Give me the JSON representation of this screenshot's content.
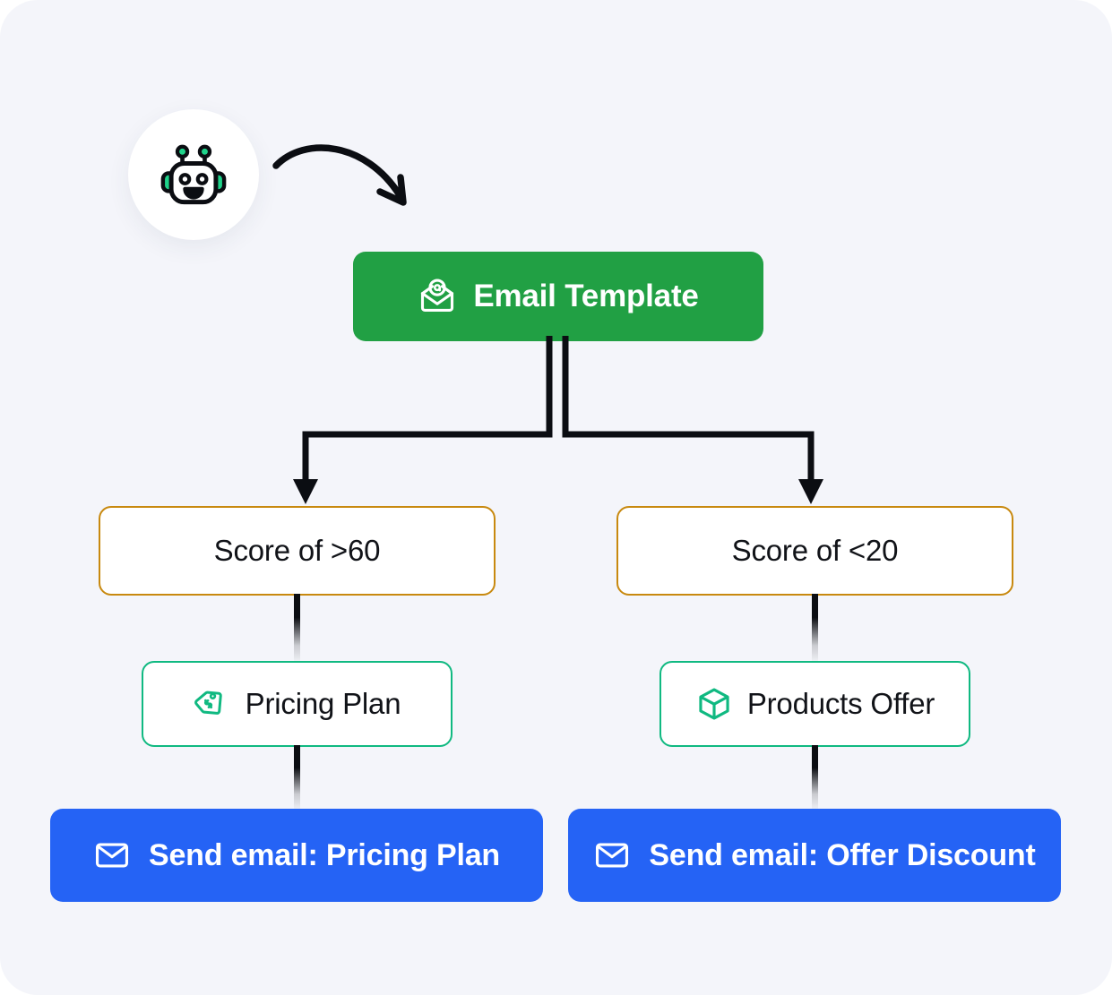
{
  "canvas": {
    "background_color": "#F4F5FA",
    "corner_radius": "42px"
  },
  "avatar": {
    "name": "ai-assistant-robot",
    "icon": "robot-face-icon",
    "accent_color": "#1FD38A",
    "outline_color": "#0B0D12",
    "background_color": "#FFFFFF"
  },
  "arrow": {
    "name": "curved-pointer-arrow",
    "icon": "curved-arrow-icon",
    "color": "#0B0D12"
  },
  "flow": {
    "trigger": {
      "label": "Email Template",
      "icon": "envelope-at-icon",
      "background_color": "#21A044",
      "text_color": "#FFFFFF"
    },
    "conditions": [
      {
        "label": "Score of >60",
        "border_color": "#C8890F",
        "background_color": "#FFFFFF",
        "text_color": "#111318"
      },
      {
        "label": "Score of <20",
        "border_color": "#C8890F",
        "background_color": "#FFFFFF",
        "text_color": "#111318"
      }
    ],
    "offers": [
      {
        "label": "Pricing Plan",
        "icon": "price-tag-icon",
        "border_color": "#10B981",
        "background_color": "#FFFFFF",
        "text_color": "#111318"
      },
      {
        "label": "Products Offer",
        "icon": "box-cube-icon",
        "border_color": "#10B981",
        "background_color": "#FFFFFF",
        "text_color": "#111318"
      }
    ],
    "actions": [
      {
        "label": "Send email: Pricing Plan",
        "icon": "envelope-icon",
        "background_color": "#2563F5",
        "text_color": "#FFFFFF"
      },
      {
        "label": "Send email: Offer Discount",
        "icon": "envelope-icon",
        "background_color": "#2563F5",
        "text_color": "#FFFFFF"
      }
    ],
    "connectors": {
      "color": "#0B0D12",
      "style": "elbow-with-arrowheads"
    }
  }
}
